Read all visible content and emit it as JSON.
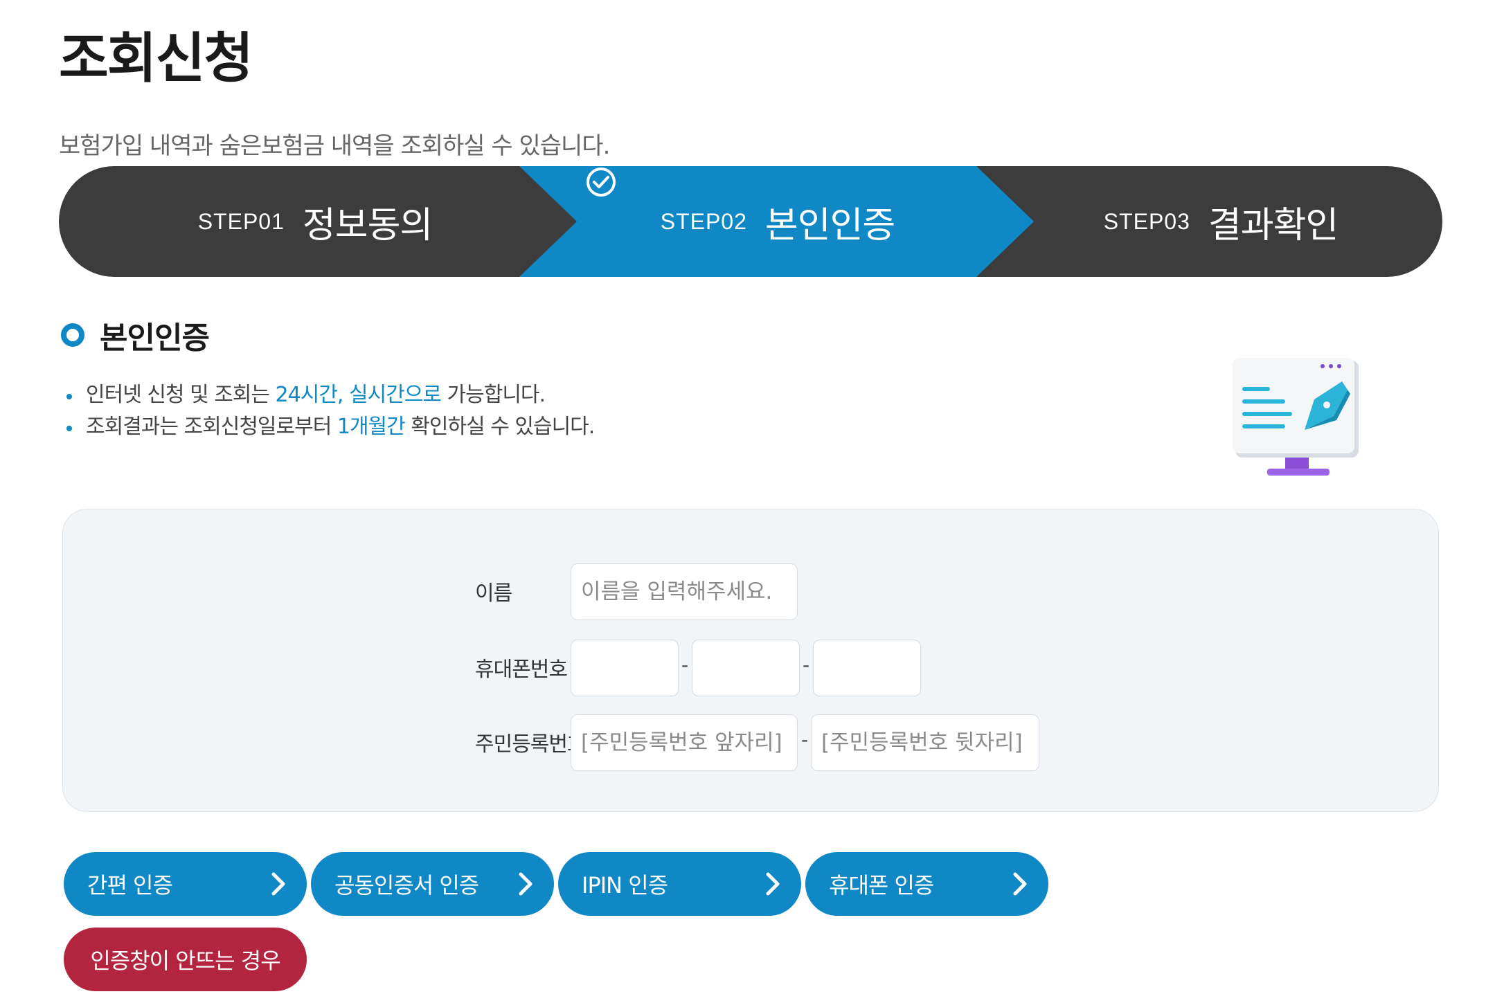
{
  "page": {
    "title": "조회신청",
    "description": "보험가입 내역과 숨은보험금 내역을 조회하실 수 있습니다."
  },
  "steps": [
    {
      "num": "STEP01",
      "name": "정보동의",
      "active": false
    },
    {
      "num": "STEP02",
      "name": "본인인증",
      "active": true
    },
    {
      "num": "STEP03",
      "name": "결과확인",
      "active": false
    }
  ],
  "section": {
    "title": "본인인증",
    "notes": [
      {
        "pre": "인터넷 신청 및 조회는 ",
        "highlight": "24시간, 실시간으로",
        "post": " 가능합니다."
      },
      {
        "pre": "조회결과는 조회신청일로부터 ",
        "highlight": "1개월간",
        "post": " 확인하실 수 있습니다."
      }
    ]
  },
  "form": {
    "name_label": "이름",
    "name_placeholder": "이름을 입력해주세요.",
    "phone_label": "휴대폰번호",
    "phone_separator": "-",
    "rrn_label": "주민등록번호",
    "rrn_front_placeholder": "[주민등록번호 앞자리]",
    "rrn_back_placeholder": "[주민등록번호 뒷자리]",
    "rrn_separator": "-"
  },
  "buttons": {
    "simple_auth": "간편 인증",
    "cert_auth": "공동인증서 인증",
    "ipin_auth": "IPIN 인증",
    "phone_auth": "휴대폰 인증",
    "popup_help": "인증창이 안뜨는 경우"
  },
  "icons": {
    "step_check": "check-circle-icon",
    "button_arrow": "chevron-right-icon",
    "illustration": "monitor-pen-icon"
  },
  "colors": {
    "accent": "#1088c5",
    "step_dark": "#3c3c3c",
    "danger": "#b3243f",
    "form_bg": "#f2f5f8"
  }
}
